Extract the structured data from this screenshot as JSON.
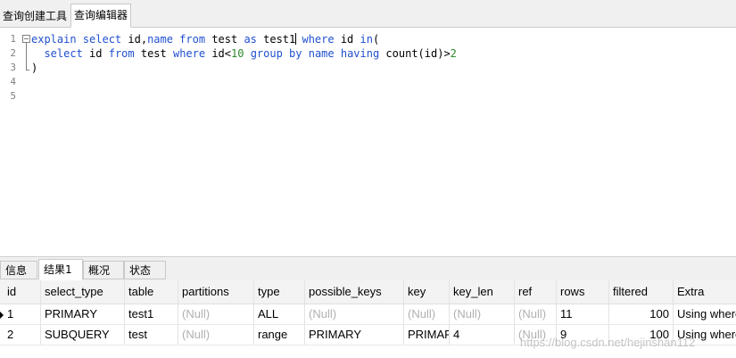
{
  "top_tabs": [
    "查询创建工具",
    "查询编辑器"
  ],
  "editor": {
    "line_numbers": [
      "1",
      "2",
      "3",
      "4",
      "5"
    ],
    "lines": [
      [
        {
          "t": "explain select ",
          "c": "kw"
        },
        {
          "t": "id,",
          "c": ""
        },
        {
          "t": "name from ",
          "c": "kw"
        },
        {
          "t": "test ",
          "c": ""
        },
        {
          "t": "as ",
          "c": "kw"
        },
        {
          "t": "test1",
          "c": ""
        },
        {
          "t": "",
          "c": "caret"
        },
        {
          "t": " where ",
          "c": "kw"
        },
        {
          "t": "id ",
          "c": ""
        },
        {
          "t": "in",
          "c": "kw"
        },
        {
          "t": "(",
          "c": ""
        }
      ],
      [
        {
          "t": "  select ",
          "c": "kw"
        },
        {
          "t": "id ",
          "c": ""
        },
        {
          "t": "from ",
          "c": "kw"
        },
        {
          "t": "test ",
          "c": ""
        },
        {
          "t": "where ",
          "c": "kw"
        },
        {
          "t": "id<",
          "c": ""
        },
        {
          "t": "10 ",
          "c": "num"
        },
        {
          "t": "group by name having ",
          "c": "kw"
        },
        {
          "t": "count(id)>",
          "c": ""
        },
        {
          "t": "2",
          "c": "num"
        }
      ],
      [
        {
          "t": ")",
          "c": ""
        }
      ]
    ]
  },
  "result_tabs": [
    "信息",
    "结果1",
    "概况",
    "状态"
  ],
  "result_tabs_active": 1,
  "table": {
    "columns": [
      "id",
      "select_type",
      "table",
      "partitions",
      "type",
      "possible_keys",
      "key",
      "key_len",
      "ref",
      "rows",
      "filtered",
      "Extra"
    ],
    "rows": [
      [
        "1",
        "PRIMARY",
        "test1",
        "(Null)",
        "ALL",
        "(Null)",
        "(Null)",
        "(Null)",
        "(Null)",
        "11",
        "100",
        "Using where"
      ],
      [
        "2",
        "SUBQUERY",
        "test",
        "(Null)",
        "range",
        "PRIMARY",
        "PRIMARY",
        "4",
        "(Null)",
        "9",
        "100",
        "Using where"
      ]
    ]
  },
  "watermark": "https://blog.csdn.net/hejinshan112"
}
